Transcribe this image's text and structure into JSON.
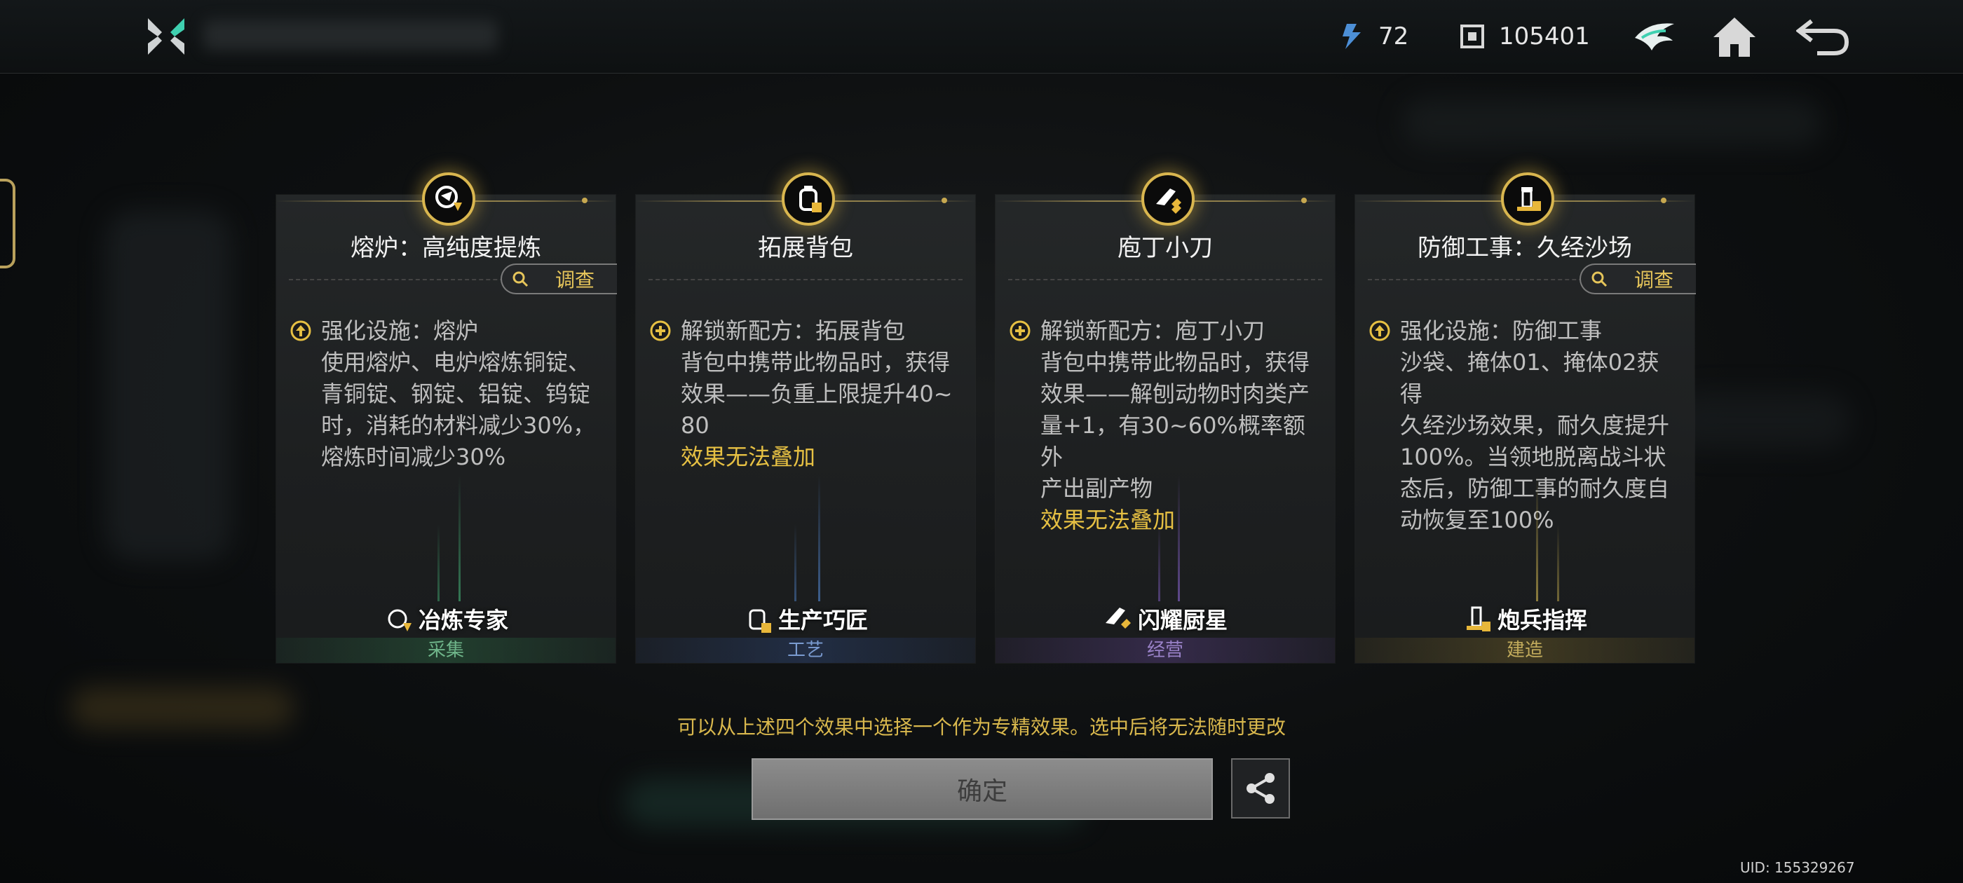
{
  "topbar": {
    "resource1": {
      "icon": "energy-crystal-icon",
      "value": "72"
    },
    "resource2": {
      "icon": "currency-chip-icon",
      "value": "105401"
    }
  },
  "cards": [
    {
      "title": "熔炉：高纯度提炼",
      "investigate": "调查",
      "effect_type": "upgrade",
      "headline": "强化设施：熔炉",
      "body": "使用熔炉、电炉熔炼铜锭、\n青铜锭、钢锭、铝锭、钨锭\n时，消耗的材料减少30%，\n熔炼时间减少30%",
      "warn": "",
      "profession": "冶炼专家",
      "category": "采集",
      "accent": "#3e9c6a"
    },
    {
      "title": "拓展背包",
      "investigate": "",
      "effect_type": "unlock",
      "headline": "解锁新配方：拓展背包",
      "body": "背包中携带此物品时，获得\n效果——负重上限提升40~\n80",
      "warn": "效果无法叠加",
      "profession": "生产巧匠",
      "category": "工艺",
      "accent": "#4a78b8"
    },
    {
      "title": "庖丁小刀",
      "investigate": "",
      "effect_type": "unlock",
      "headline": "解锁新配方：庖丁小刀",
      "body": "背包中携带此物品时，获得\n效果——解刨动物时肉类产\n量+1，有30~60%概率额外\n产出副产物",
      "warn": "效果无法叠加",
      "profession": "闪耀厨星",
      "category": "经营",
      "accent": "#7a5ab8"
    },
    {
      "title": "防御工事：久经沙场",
      "investigate": "调查",
      "effect_type": "upgrade",
      "headline": "强化设施：防御工事",
      "body": "沙袋、掩体01、掩体02获得\n久经沙场效果，耐久度提升\n100%。当领地脱离战斗状\n态后，防御工事的耐久度自\n动恢复至100%",
      "warn": "",
      "profession": "炮兵指挥",
      "category": "建造",
      "accent": "#b8a24a"
    }
  ],
  "hint": "可以从上述四个效果中选择一个作为专精效果。选中后将无法随时更改",
  "confirm_label": "确定",
  "uid": "UID: 155329267"
}
